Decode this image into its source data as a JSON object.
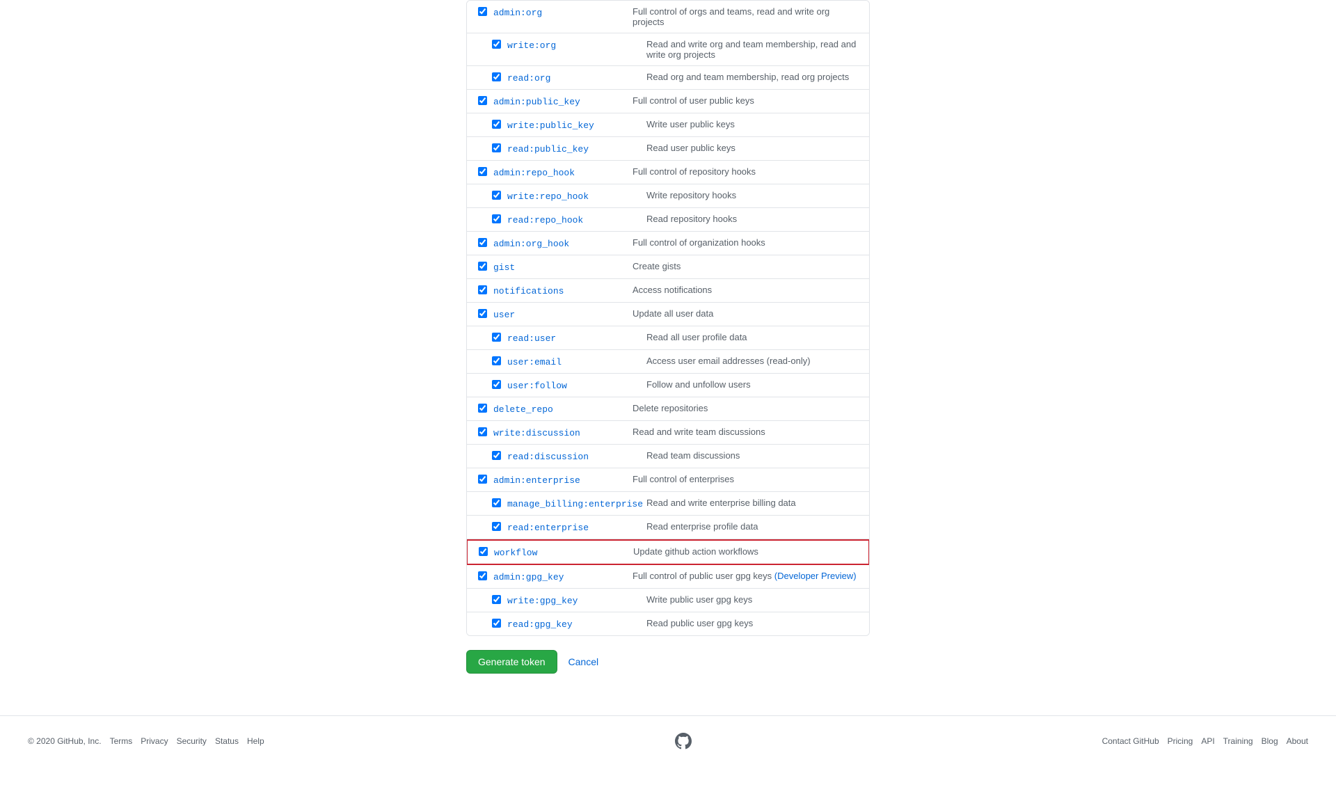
{
  "scopes": [
    {
      "id": "admin_org",
      "name": "admin:org",
      "description": "Full control of orgs and teams, read and write org projects",
      "checked": true,
      "indentLevel": 0,
      "children": [
        {
          "id": "write_org",
          "name": "write:org",
          "description": "Read and write org and team membership, read and write org projects",
          "checked": true,
          "indentLevel": 1
        },
        {
          "id": "read_org",
          "name": "read:org",
          "description": "Read org and team membership, read org projects",
          "checked": true,
          "indentLevel": 1
        }
      ]
    },
    {
      "id": "admin_public_key",
      "name": "admin:public_key",
      "description": "Full control of user public keys",
      "checked": true,
      "indentLevel": 0,
      "children": [
        {
          "id": "write_public_key",
          "name": "write:public_key",
          "description": "Write user public keys",
          "checked": true,
          "indentLevel": 1
        },
        {
          "id": "read_public_key",
          "name": "read:public_key",
          "description": "Read user public keys",
          "checked": true,
          "indentLevel": 1
        }
      ]
    },
    {
      "id": "admin_repo_hook",
      "name": "admin:repo_hook",
      "description": "Full control of repository hooks",
      "checked": true,
      "indentLevel": 0,
      "children": [
        {
          "id": "write_repo_hook",
          "name": "write:repo_hook",
          "description": "Write repository hooks",
          "checked": true,
          "indentLevel": 1
        },
        {
          "id": "read_repo_hook",
          "name": "read:repo_hook",
          "description": "Read repository hooks",
          "checked": true,
          "indentLevel": 1
        }
      ]
    },
    {
      "id": "admin_org_hook",
      "name": "admin:org_hook",
      "description": "Full control of organization hooks",
      "checked": true,
      "indentLevel": 0,
      "children": []
    },
    {
      "id": "gist",
      "name": "gist",
      "description": "Create gists",
      "checked": true,
      "indentLevel": 0,
      "children": []
    },
    {
      "id": "notifications",
      "name": "notifications",
      "description": "Access notifications",
      "checked": true,
      "indentLevel": 0,
      "children": []
    },
    {
      "id": "user",
      "name": "user",
      "description": "Update all user data",
      "checked": true,
      "indentLevel": 0,
      "children": [
        {
          "id": "read_user",
          "name": "read:user",
          "description": "Read all user profile data",
          "checked": true,
          "indentLevel": 1
        },
        {
          "id": "user_email",
          "name": "user:email",
          "description": "Access user email addresses (read-only)",
          "checked": true,
          "indentLevel": 1
        },
        {
          "id": "user_follow",
          "name": "user:follow",
          "description": "Follow and unfollow users",
          "checked": true,
          "indentLevel": 1
        }
      ]
    },
    {
      "id": "delete_repo",
      "name": "delete_repo",
      "description": "Delete repositories",
      "checked": true,
      "indentLevel": 0,
      "children": []
    },
    {
      "id": "write_discussion",
      "name": "write:discussion",
      "description": "Read and write team discussions",
      "checked": true,
      "indentLevel": 0,
      "children": [
        {
          "id": "read_discussion",
          "name": "read:discussion",
          "description": "Read team discussions",
          "checked": true,
          "indentLevel": 1
        }
      ]
    },
    {
      "id": "admin_enterprise",
      "name": "admin:enterprise",
      "description": "Full control of enterprises",
      "checked": true,
      "indentLevel": 0,
      "children": [
        {
          "id": "manage_billing_enterprise",
          "name": "manage_billing:enterprise",
          "description": "Read and write enterprise billing data",
          "checked": true,
          "indentLevel": 1
        },
        {
          "id": "read_enterprise",
          "name": "read:enterprise",
          "description": "Read enterprise profile data",
          "checked": true,
          "indentLevel": 1
        }
      ]
    },
    {
      "id": "workflow",
      "name": "workflow",
      "description": "Update github action workflows",
      "checked": true,
      "indentLevel": 0,
      "highlighted": true,
      "children": []
    },
    {
      "id": "admin_gpg_key",
      "name": "admin:gpg_key",
      "description": "Full control of public user gpg keys",
      "descriptionLink": "Developer Preview",
      "descriptionLinkText": "(Developer Preview)",
      "checked": true,
      "indentLevel": 0,
      "children": [
        {
          "id": "write_gpg_key",
          "name": "write:gpg_key",
          "description": "Write public user gpg keys",
          "checked": true,
          "indentLevel": 1
        },
        {
          "id": "read_gpg_key",
          "name": "read:gpg_key",
          "description": "Read public user gpg keys",
          "checked": true,
          "indentLevel": 1
        }
      ]
    }
  ],
  "actions": {
    "generate_label": "Generate token",
    "cancel_label": "Cancel"
  },
  "footer": {
    "copyright": "© 2020 GitHub, Inc.",
    "links_left": [
      "Terms",
      "Privacy",
      "Security",
      "Status",
      "Help"
    ],
    "links_right": [
      "Contact GitHub",
      "Pricing",
      "API",
      "Training",
      "Blog",
      "About"
    ]
  }
}
